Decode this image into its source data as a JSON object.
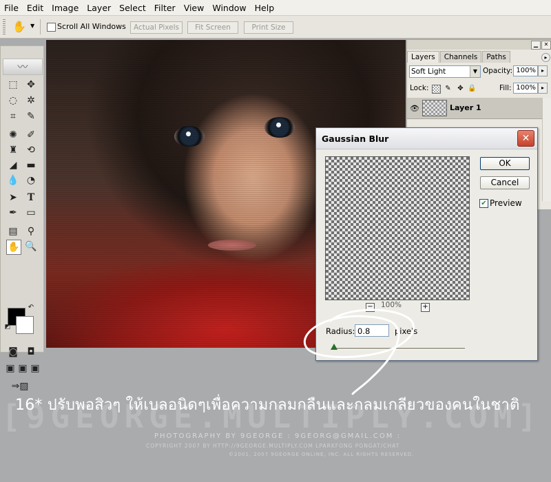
{
  "menu": [
    "File",
    "Edit",
    "Image",
    "Layer",
    "Select",
    "Filter",
    "View",
    "Window",
    "Help"
  ],
  "options": {
    "scroll_all": "Scroll All Windows",
    "actual_pixels": "Actual Pixels",
    "fit_screen": "Fit Screen",
    "print_size": "Print Size"
  },
  "layers_panel": {
    "tabs": [
      "Layers",
      "Channels",
      "Paths"
    ],
    "blend_mode": "Soft Light",
    "opacity_label": "Opacity:",
    "opacity_value": "100%",
    "lock_label": "Lock:",
    "fill_label": "Fill:",
    "fill_value": "100%",
    "layer_name": "Layer 1"
  },
  "dialog": {
    "title": "Gaussian Blur",
    "ok": "OK",
    "cancel": "Cancel",
    "preview_label": "Preview",
    "zoom": "100%",
    "radius_label": "Radius:",
    "radius_value": "0.8",
    "unit": "pixels"
  },
  "caption": "16* ปรับพอสิวๆ ให้เบลอนิดๆเพื่อความกลมกลืนและกลมเกลียวของคนในชาติ",
  "watermark": "[9GEORGE.MULTIPLY.COM]",
  "credits": {
    "line1": "PHOTOGRAPHY BY 9GEORGE : 9GEORG@GMAIL.COM :",
    "line2": "COPYRIGHT 2007 BY  HTTP://9GEORGE.MULTIPLY.COM  LPARKFONG PONGAT/CHAT",
    "line3": "©2001, 2007 9GEORGE ONLINE, INC. ALL RIGHTS RESERVED."
  },
  "colors": {
    "foreground": "#000000",
    "background": "#ffffff",
    "close_button": "#c5402b"
  }
}
